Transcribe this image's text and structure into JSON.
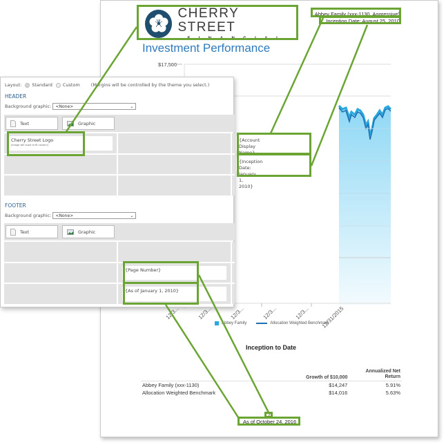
{
  "report": {
    "logo": {
      "name": "CHERRY STREET",
      "subtitle": "FINANCIAL",
      "icon": "cherry-blossom-icon",
      "brand_color": "#1f4e6e"
    },
    "account_display_name": "Abbey Family (xxx-1130, Aggressive)",
    "inception_date": "Inception Date: August 25, 2010",
    "title": "Investment Performance",
    "title_color": "#2f7bbd",
    "chart": {
      "y_top_tick": "$17,500",
      "x_ticks": [
        "12/3...",
        "12/3...",
        "12/3...",
        "12/3...",
        "12/3...",
        "12/31/2015"
      ],
      "legend": [
        {
          "label": "Abbey Family",
          "type": "area",
          "color": "#29a8e0"
        },
        {
          "label": "Allocation Weighted Benchmark",
          "type": "line",
          "color": "#1f6fb0"
        }
      ]
    },
    "inception_to_date": {
      "title": "Inception to Date",
      "columns": [
        "",
        "Growth of $10,000",
        "Annualized Net Return"
      ],
      "rows": [
        {
          "name": "Abbey Family (xxx-1130)",
          "growth": "$14,247",
          "return": "5.91%"
        },
        {
          "name": "Allocation Weighted Benchmark",
          "growth": "$14,016",
          "return": "5.63%"
        }
      ]
    },
    "page_number": "2",
    "as_of": "As of October 24, 2016"
  },
  "dialog": {
    "layout_label": "Layout:",
    "layout_options": [
      {
        "label": "Standard",
        "checked": true
      },
      {
        "label": "Custom",
        "checked": false
      }
    ],
    "layout_note": "(Margins will be controlled by the theme you select.)",
    "header": {
      "label": "HEADER",
      "bg_label": "Background graphic:",
      "bg_value": "<None>",
      "text_button": "Text",
      "graphic_button": "Graphic",
      "cells": {
        "logo_title": "Cherry Street Logo",
        "logo_note": "(Image will scale to fit column)",
        "account_name": "{Account Display Name}",
        "inception": "{Inception Date: January 1, 2010}"
      }
    },
    "footer": {
      "label": "FOOTER",
      "bg_label": "Background graphic:",
      "bg_value": "<None>",
      "text_button": "Text",
      "graphic_button": "Graphic",
      "cells": {
        "page_number": "{Page Number}",
        "as_of": "{As of January 1, 2010}"
      }
    }
  },
  "callout_color": "#6aa534"
}
